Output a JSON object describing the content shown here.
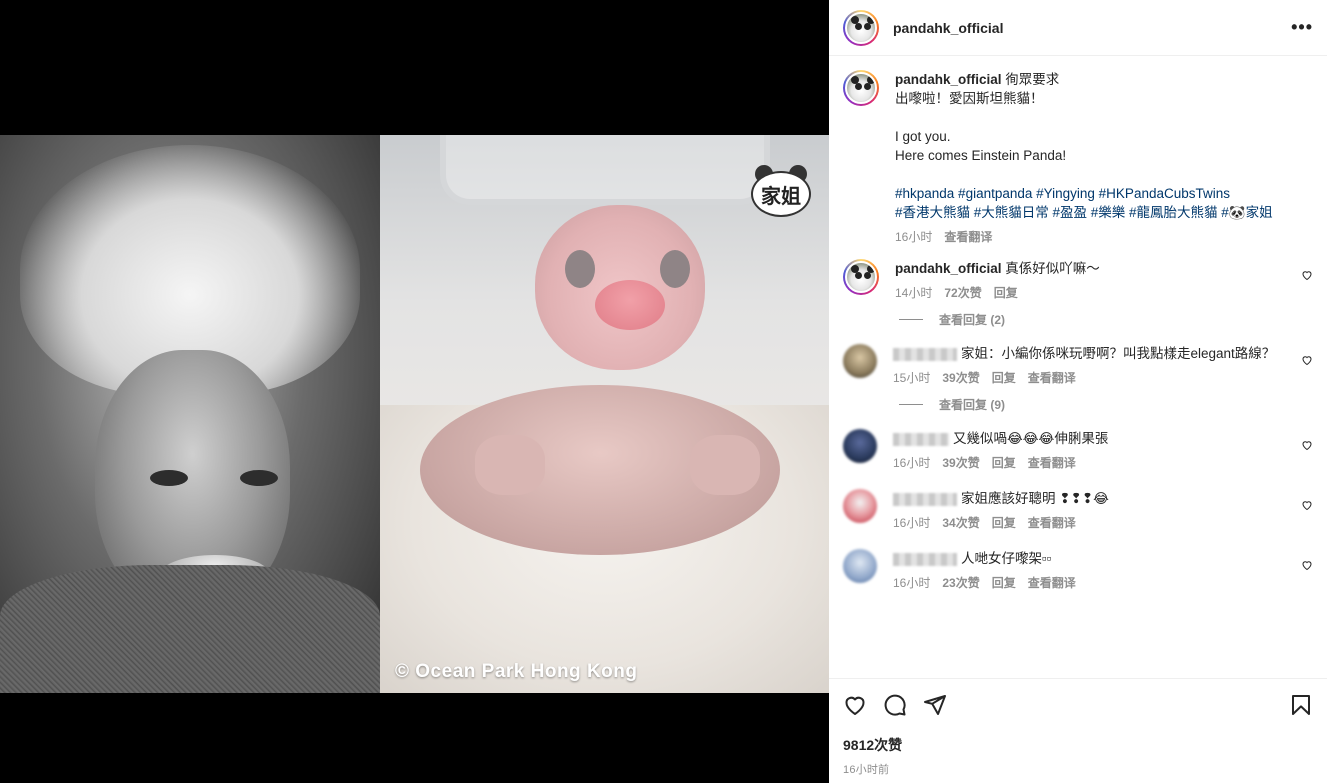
{
  "post": {
    "username": "pandahk_official",
    "watermark": "© Ocean Park Hong Kong",
    "badge_text": "家姐",
    "likes": "9812次赞",
    "time_ago": "16小时前"
  },
  "caption": {
    "username": "pandahk_official",
    "line1": "徇眾要求",
    "line2": "出嚟啦！愛因斯坦熊貓！",
    "line3": "I got you.",
    "line4": "Here comes Einstein Panda!",
    "hashtags1": "#hkpanda #giantpanda #Yingying #HKPandaCubsTwins",
    "hashtags2": "#香港大熊貓 #大熊貓日常 #盈盈 #樂樂 #龍鳳胎大熊貓 #🐼家姐",
    "time": "16小时",
    "translate": "查看翻译"
  },
  "comments": [
    {
      "username": "pandahk_official",
      "text": "真係好似吖嘛～",
      "time": "14小时",
      "likes": "72次赞",
      "reply": "回复",
      "view_replies": "查看回复 (2)"
    },
    {
      "username": "j___mo___i",
      "text": "家姐：小編你係咪玩嘢啊？叫我點樣走elegant路線？",
      "time": "15小时",
      "likes": "39次赞",
      "reply": "回复",
      "translate": "查看翻译",
      "view_replies": "查看回复 (9)",
      "avatar_color": "#8a7a5c"
    },
    {
      "text": "又幾似喎😂😂😂伸脷果張",
      "time": "16小时",
      "likes": "39次赞",
      "reply": "回复",
      "translate": "查看翻译",
      "avatar_color": "#2a3a5c"
    },
    {
      "text": "家姐應該好聰明 ❢❢❢😂",
      "time": "16小时",
      "likes": "34次赞",
      "reply": "回复",
      "translate": "查看翻译",
      "avatar_color": "#c0303f"
    },
    {
      "text": "人哋女仔嚟架▫▫",
      "time": "16小时",
      "likes": "23次赞",
      "reply": "回复",
      "translate": "查看翻译",
      "avatar_color": "#8fa6c9"
    }
  ]
}
